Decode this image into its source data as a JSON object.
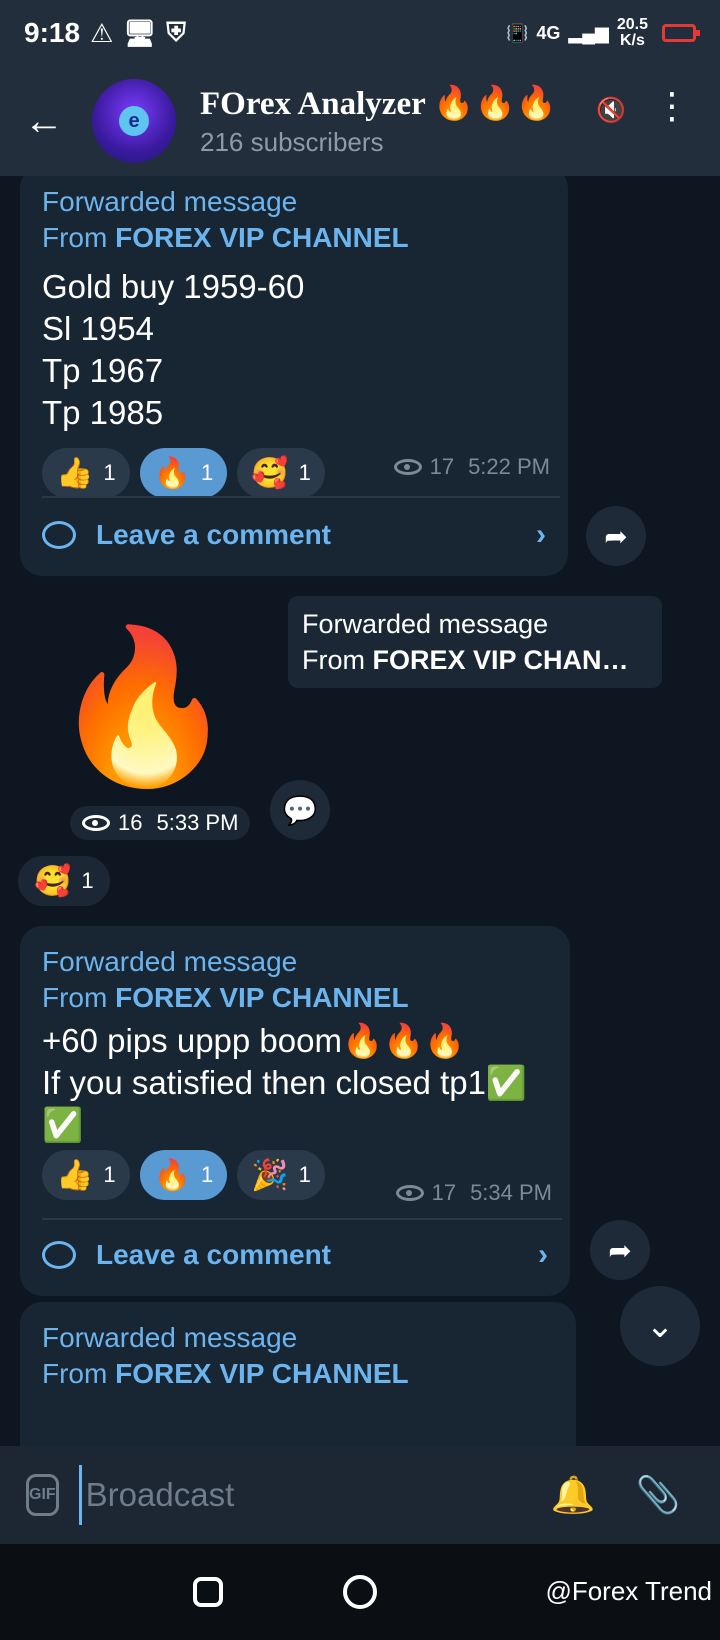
{
  "status": {
    "time": "9:18",
    "net_speed_top": "20.5",
    "net_speed_bottom": "K/s",
    "net_type": "4G"
  },
  "header": {
    "title": "FOrex Analyzer 🔥🔥🔥",
    "subtitle": "216 subscribers"
  },
  "messages": [
    {
      "forwarded_label": "Forwarded message",
      "from_prefix": "From ",
      "from_name": "FOREX VIP CHANNEL",
      "lines": [
        "Gold buy 1959-60",
        "Sl 1954",
        "Tp 1967",
        "Tp 1985"
      ],
      "reactions": [
        {
          "emoji": "👍",
          "count": "1"
        },
        {
          "emoji": "🔥",
          "count": "1"
        },
        {
          "emoji": "🥰",
          "count": "1"
        }
      ],
      "views": "17",
      "time": "5:22 PM",
      "comment_label": "Leave a comment"
    },
    {
      "forwarded_label": "Forwarded message",
      "from_prefix": "From ",
      "from_name": "FOREX VIP CHAN…",
      "sticker": "🔥",
      "views": "16",
      "time": "5:33 PM",
      "reaction": {
        "emoji": "🥰",
        "count": "1"
      }
    },
    {
      "forwarded_label": "Forwarded message",
      "from_prefix": "From ",
      "from_name": "FOREX VIP CHANNEL",
      "lines": [
        "+60 pips uppp boom🔥🔥🔥",
        "If you satisfied then closed tp1✅",
        "✅"
      ],
      "reactions": [
        {
          "emoji": "👍",
          "count": "1"
        },
        {
          "emoji": "🔥",
          "count": "1"
        },
        {
          "emoji": "🎉",
          "count": "1"
        }
      ],
      "views": "17",
      "time": "5:34 PM",
      "comment_label": "Leave a comment"
    },
    {
      "forwarded_label": "Forwarded message",
      "from_prefix": "From ",
      "from_name": "FOREX VIP CHANNEL"
    }
  ],
  "input": {
    "placeholder": "Broadcast",
    "gif_label": "GIF"
  },
  "watermark": "@Forex Trend"
}
